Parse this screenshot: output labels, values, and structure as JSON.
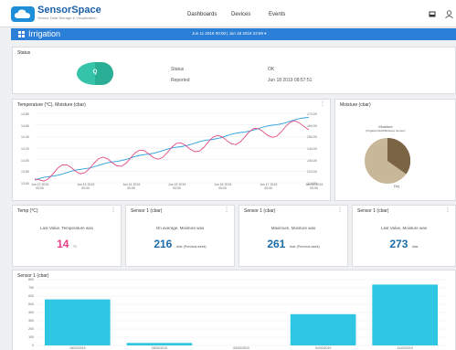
{
  "app": {
    "name": "SensorSpace",
    "tagline": "Sensor Data Storage & Visualization"
  },
  "nav": {
    "items": [
      "Dashboards",
      "Devices",
      "Events"
    ]
  },
  "toolbar": {
    "page_title": "Irrigation",
    "date_range": "Jun 11 2019 00:00 | Jun 18 2019 23:59 ▾"
  },
  "status_card": {
    "title": "Status",
    "indicator": "Q",
    "rows": [
      {
        "label": "Status",
        "value": "OK"
      },
      {
        "label": "Reported",
        "value": "Jun 18 2019 08:57:51"
      }
    ]
  },
  "line_card": {
    "title": "Temperature (°C), Moisture (cbar)",
    "left_ticks": [
      "14.80",
      "14.60",
      "14.40",
      "14.20",
      "14.00",
      "13.80",
      "13.60"
    ],
    "right_ticks": [
      "274.00",
      "264.00",
      "254.00",
      "244.00",
      "234.00",
      "224.00",
      "214.00"
    ],
    "x_ticks": [
      "Jun 12 2019\n00:00",
      "Jun 13 2019\n00:00",
      "Jun 14 2019\n00:00",
      "Jun 15 2019\n00:00",
      "Jun 16 2019\n00:00",
      "Jun 17 2019\n00:00",
      "Jun 18 2019\n00:00"
    ]
  },
  "pie_card": {
    "title": "Moisture (cbar)",
    "pie_title": "Moisture",
    "pie_subtitle": "(Irrigation/Hold/Moisture Sensor)",
    "slice_label": "Dry"
  },
  "stat_cards": [
    {
      "title": "Temp (°C)",
      "label": "Last Value, Temperature was",
      "value": "14",
      "unit": "°C",
      "pink": true
    },
    {
      "title": "Sensor 1 (cbar)",
      "label": "On average, Moisture was",
      "value": "216",
      "unit": "cbar (Previous week)",
      "pink": false
    },
    {
      "title": "Sensor 1 (cbar)",
      "label": "Maximum, Moisture was",
      "value": "261",
      "unit": "cbar (Previous week)",
      "pink": false
    },
    {
      "title": "Sensor 1 (cbar)",
      "label": "Last Value, Moisture was",
      "value": "273",
      "unit": "cbar",
      "pink": false
    }
  ],
  "bar_card": {
    "title": "Sensor 1 (cbar)"
  },
  "chart_data": {
    "type": "bar",
    "title": "Sensor 1 (cbar)",
    "categories": [
      "18/02/2019",
      "25/02/2019",
      "04/03/2019",
      "04/03/2019",
      "11/03/2019"
    ],
    "values": [
      560,
      30,
      0,
      380,
      740
    ],
    "y_ticks": [
      "800",
      "700",
      "600",
      "500",
      "400",
      "300",
      "200",
      "100",
      "0"
    ],
    "ylim": [
      0,
      800
    ],
    "color": "#2ec6e2"
  },
  "colors": {
    "accent": "#2b7fd6",
    "bar": "#2ec6e2",
    "temp_line": "#e24b86",
    "moist_line": "#2ba0e0"
  }
}
